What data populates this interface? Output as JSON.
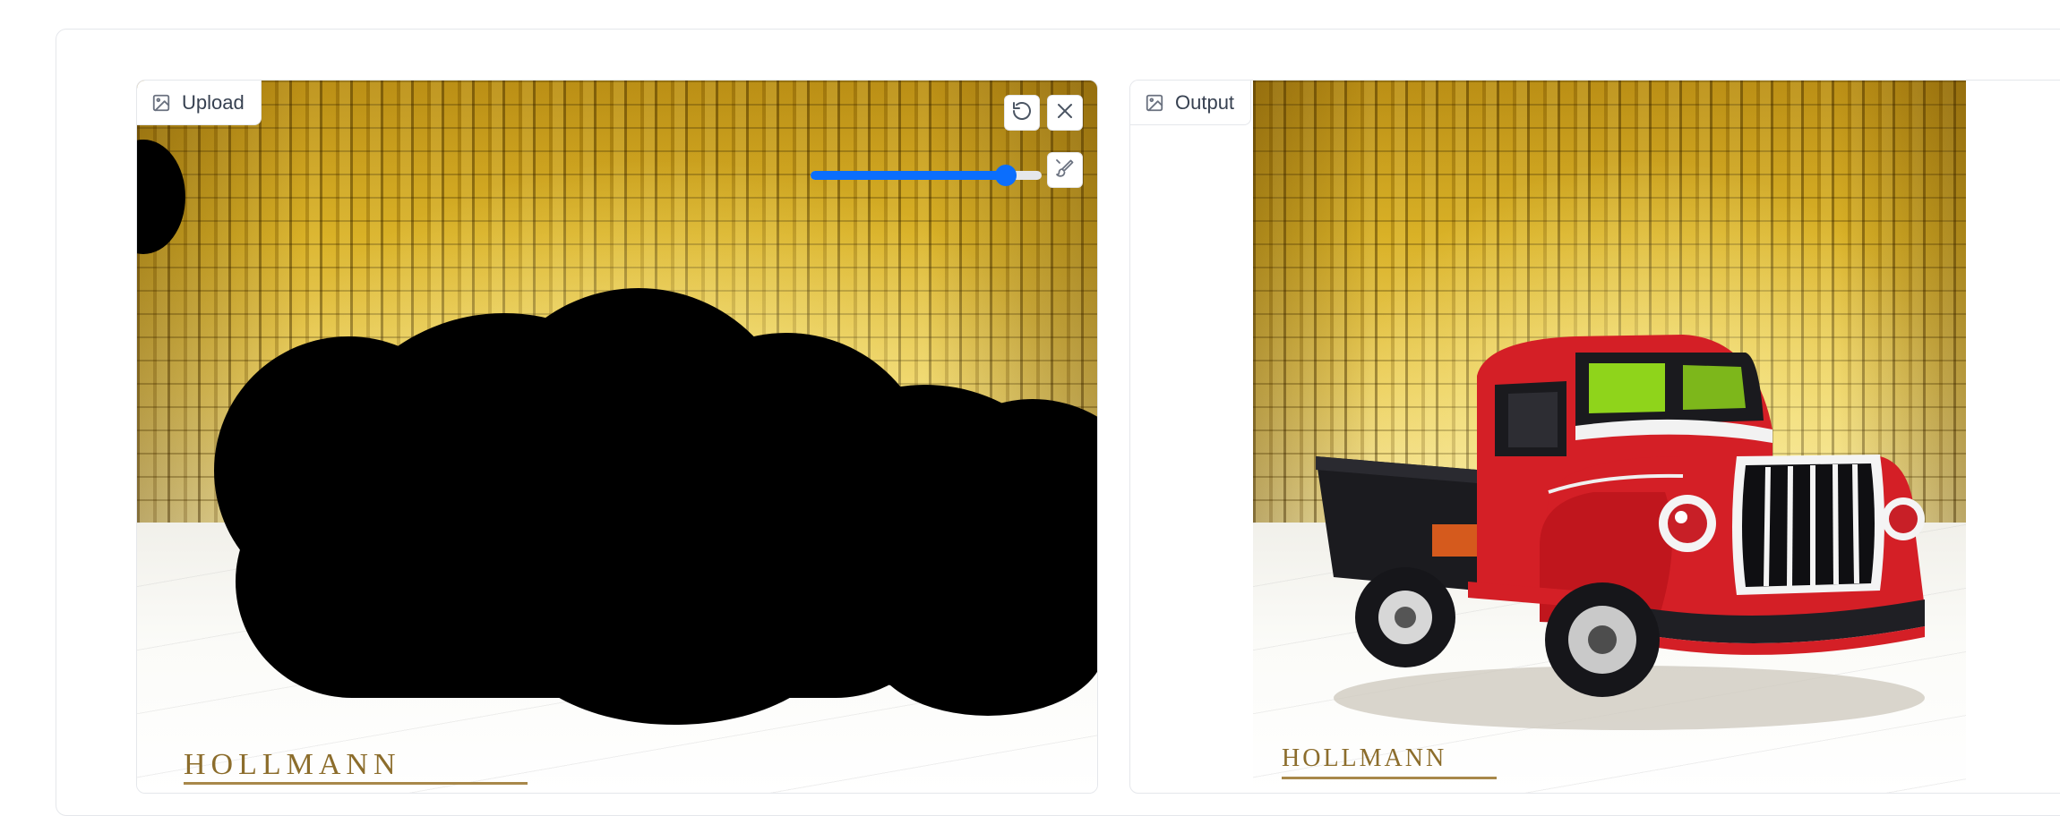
{
  "upload_panel": {
    "label": "Upload",
    "brush_size": 0.88,
    "brand_text": "HOLLMANN"
  },
  "output_panel": {
    "label": "Output",
    "brand_text": "HOLLMANN"
  },
  "icons": {
    "image": "image-icon",
    "undo": "undo-icon",
    "clear": "close-icon",
    "brush": "brush-icon"
  },
  "colors": {
    "accent": "#0b6efd",
    "border": "#e5e7eb",
    "label_text": "#374151",
    "mask": "#000000",
    "truck_red": "#d41f26"
  }
}
